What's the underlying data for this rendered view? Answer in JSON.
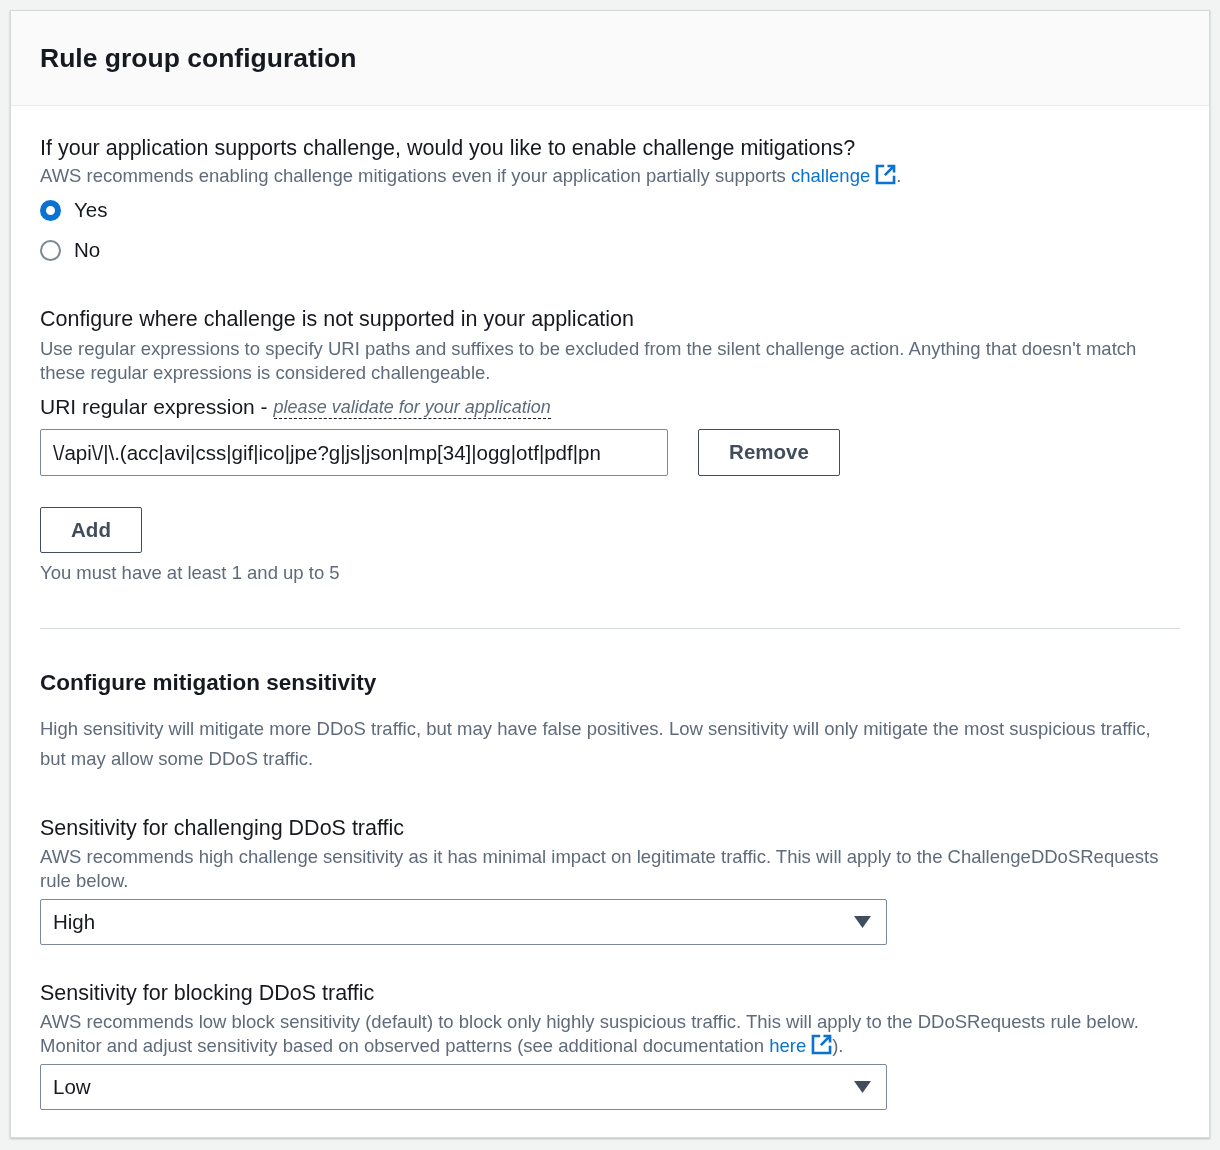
{
  "panel": {
    "title": "Rule group configuration"
  },
  "challenge_mitigation": {
    "question": "If your application supports challenge, would you like to enable challenge mitigations?",
    "description": "AWS recommends enabling challenge mitigations even if your application partially supports ",
    "link": "challenge",
    "description_end": ".",
    "options": [
      {
        "label": "Yes",
        "selected": true
      },
      {
        "label": "No",
        "selected": false
      }
    ]
  },
  "exclusions": {
    "title": "Configure where challenge is not supported in your application",
    "description": "Use regular expressions to specify URI paths and suffixes to be excluded from the silent challenge action. Anything that doesn't match these regular expressions is considered challengeable.",
    "field_label": "URI regular expression -",
    "field_hint": "please validate for your application",
    "entries": [
      {
        "value": "\\/api\\/|\\.(acc|avi|css|gif|ico|jpe?g|js|json|mp[34]|ogg|otf|pdf|pn",
        "remove_button": "Remove"
      }
    ],
    "add_button": "Add",
    "constraint": "You must have at least 1 and up to 5"
  },
  "sensitivity": {
    "title": "Configure mitigation sensitivity",
    "description": "High sensitivity will mitigate more DDoS traffic, but may have false positives. Low sensitivity will only mitigate the most suspicious traffic, but may allow some DDoS traffic.",
    "settings": [
      {
        "label": "Sensitivity for challenging DDoS traffic",
        "description": "AWS recommends high challenge sensitivity as it has minimal impact on legitimate traffic. This will apply to the ChallengeDDoSRequests rule below.",
        "value": "High"
      },
      {
        "label": "Sensitivity for blocking DDoS traffic",
        "description": "AWS recommends low block sensitivity (default) to block only highly suspicious traffic. This will apply to the DDoSRequests rule below. Monitor and adjust sensitivity based on observed patterns (see additional documentation ",
        "link": "here",
        "description_end": ").",
        "value": "Low"
      }
    ]
  }
}
